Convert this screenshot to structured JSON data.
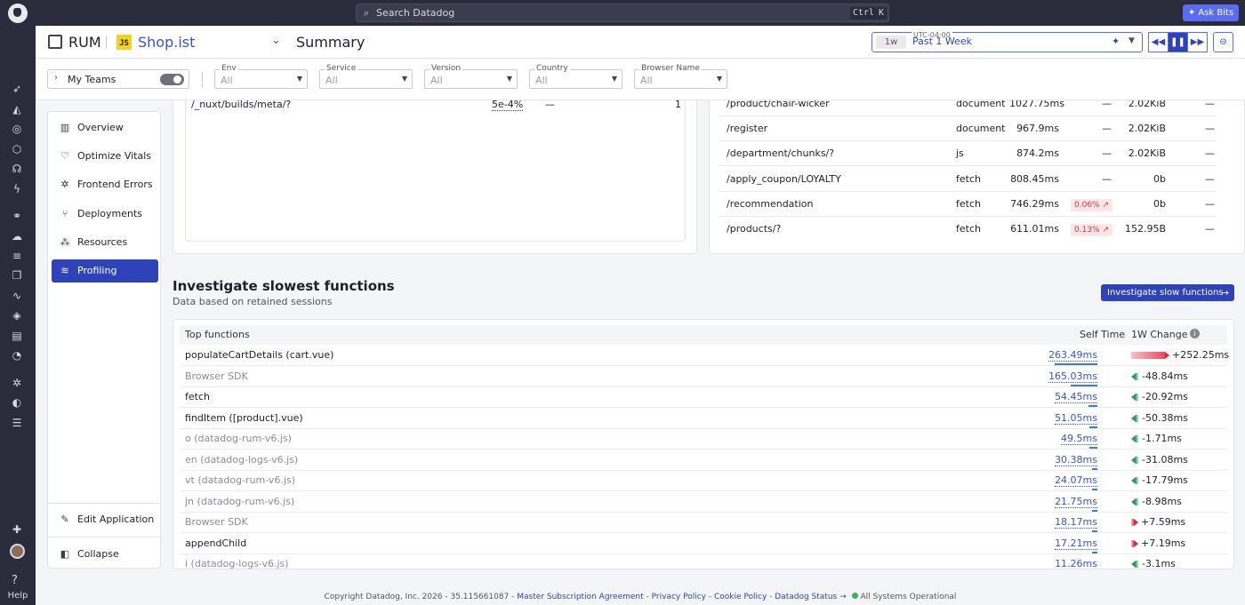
{
  "topbar": {
    "search_placeholder": "Search Datadog",
    "kbd_ctrl": "Ctrl",
    "kbd_k": "K",
    "ask_bits": "Ask Bits"
  },
  "nav": {
    "help": "Help",
    "icons": [
      "rocket-icon",
      "chart-icon",
      "apm-icon",
      "infra-icon",
      "security-icon",
      "bolt-icon",
      "service-map-icon",
      "cloud-icon",
      "logs-icon",
      "rum-icon",
      "synthetics-icon",
      "docs-icon",
      "notebook-icon",
      "incidents-icon",
      "bug-icon",
      "speed-icon",
      "list-icon",
      "integrations-icon"
    ]
  },
  "header": {
    "product": "RUM",
    "js_badge": "JS",
    "app_name": "Shop.ist",
    "page_title": "Summary",
    "timezone": "UTC-04:00",
    "time_short": "1w",
    "time_label": "Past 1 Week"
  },
  "filters": {
    "my_teams": "My Teams",
    "items": [
      {
        "label": "Env",
        "value": "All"
      },
      {
        "label": "Service",
        "value": "All"
      },
      {
        "label": "Version",
        "value": "All"
      },
      {
        "label": "Country",
        "value": "All"
      },
      {
        "label": "Browser Name",
        "value": "All"
      }
    ]
  },
  "menu": {
    "items": [
      {
        "label": "Overview"
      },
      {
        "label": "Optimize Vitals"
      },
      {
        "label": "Frontend Errors"
      },
      {
        "label": "Deployments"
      },
      {
        "label": "Resources"
      },
      {
        "label": "Profiling"
      }
    ],
    "edit_app": "Edit Application",
    "collapse": "Collapse"
  },
  "left_panel": {
    "row": {
      "path": "/_nuxt/builds/meta/?",
      "rate": "5e-4%",
      "dash": "—",
      "count": "1"
    }
  },
  "resources": {
    "rows": [
      {
        "path": "/product/chair-wicker",
        "type": "document",
        "duration": "1027.75ms",
        "change": "—",
        "size": "2.02KiB",
        "extra": "—"
      },
      {
        "path": "/register",
        "type": "document",
        "duration": "967.9ms",
        "change": "—",
        "size": "2.02KiB",
        "extra": "—"
      },
      {
        "path": "/department/chunks/?",
        "type": "js",
        "duration": "874.2ms",
        "change": "—",
        "size": "2.02KiB",
        "extra": "—"
      },
      {
        "path": "/apply_coupon/LOYALTY",
        "type": "fetch",
        "duration": "808.45ms",
        "change": "—",
        "size": "0b",
        "extra": "—"
      },
      {
        "path": "/recommendation",
        "type": "fetch",
        "duration": "746.29ms",
        "change": "0.06% ↗",
        "size": "0b",
        "extra": "—"
      },
      {
        "path": "/products/?",
        "type": "fetch",
        "duration": "611.01ms",
        "change": "0.13% ↗",
        "size": "152.95B",
        "extra": "—"
      }
    ]
  },
  "slow_functions": {
    "title": "Investigate slowest functions",
    "subtitle": "Data based on retained sessions",
    "button": "Investigate slow functions",
    "col_function": "Top functions",
    "col_self_time": "Self Time",
    "col_change": "1W Change",
    "rows": [
      {
        "name": "populateCartDetails (cart.vue)",
        "style": "dark",
        "self_time": "263.49ms",
        "time_value": 263.49,
        "change": "+252.25ms",
        "change_value": 252.25
      },
      {
        "name": "Browser SDK",
        "style": "grey",
        "self_time": "165.03ms",
        "time_value": 165.03,
        "change": "-48.84ms",
        "change_value": -48.84
      },
      {
        "name": "fetch",
        "style": "dark",
        "self_time": "54.45ms",
        "time_value": 54.45,
        "change": "-20.92ms",
        "change_value": -20.92
      },
      {
        "name": "findItem ([product].vue)",
        "style": "dark",
        "self_time": "51.05ms",
        "time_value": 51.05,
        "change": "-50.38ms",
        "change_value": -50.38
      },
      {
        "name": "o (datadog-rum-v6.js)",
        "style": "grey",
        "self_time": "49.5ms",
        "time_value": 49.5,
        "change": "-1.71ms",
        "change_value": -1.71
      },
      {
        "name": "en (datadog-logs-v6.js)",
        "style": "grey",
        "self_time": "30.38ms",
        "time_value": 30.38,
        "change": "-31.08ms",
        "change_value": -31.08
      },
      {
        "name": "vt (datadog-rum-v6.js)",
        "style": "grey",
        "self_time": "24.07ms",
        "time_value": 24.07,
        "change": "-17.79ms",
        "change_value": -17.79
      },
      {
        "name": "jn (datadog-rum-v6.js)",
        "style": "grey",
        "self_time": "21.75ms",
        "time_value": 21.75,
        "change": "-8.98ms",
        "change_value": -8.98
      },
      {
        "name": "Browser SDK",
        "style": "grey",
        "self_time": "18.17ms",
        "time_value": 18.17,
        "change": "+7.59ms",
        "change_value": 7.59
      },
      {
        "name": "appendChild",
        "style": "dark",
        "self_time": "17.21ms",
        "time_value": 17.21,
        "change": "+7.19ms",
        "change_value": 7.19
      },
      {
        "name": "i (datadog-logs-v6.js)",
        "style": "grey",
        "self_time": "11.26ms",
        "time_value": 11.26,
        "change": "-3.1ms",
        "change_value": -3.1
      }
    ]
  },
  "footer": {
    "copyright": "Copyright Datadog, Inc. 2026 - 35.115661087 -",
    "msa": "Master Subscription Agreement",
    "privacy": "Privacy Policy",
    "cookie": "Cookie Policy",
    "status": "Datadog Status →",
    "operational": "All Systems Operational"
  },
  "colors": {
    "accent": "#2f43b8",
    "nav_bg": "#2b2c3b",
    "positive": "#34b36b",
    "negative": "#e84a5f"
  }
}
